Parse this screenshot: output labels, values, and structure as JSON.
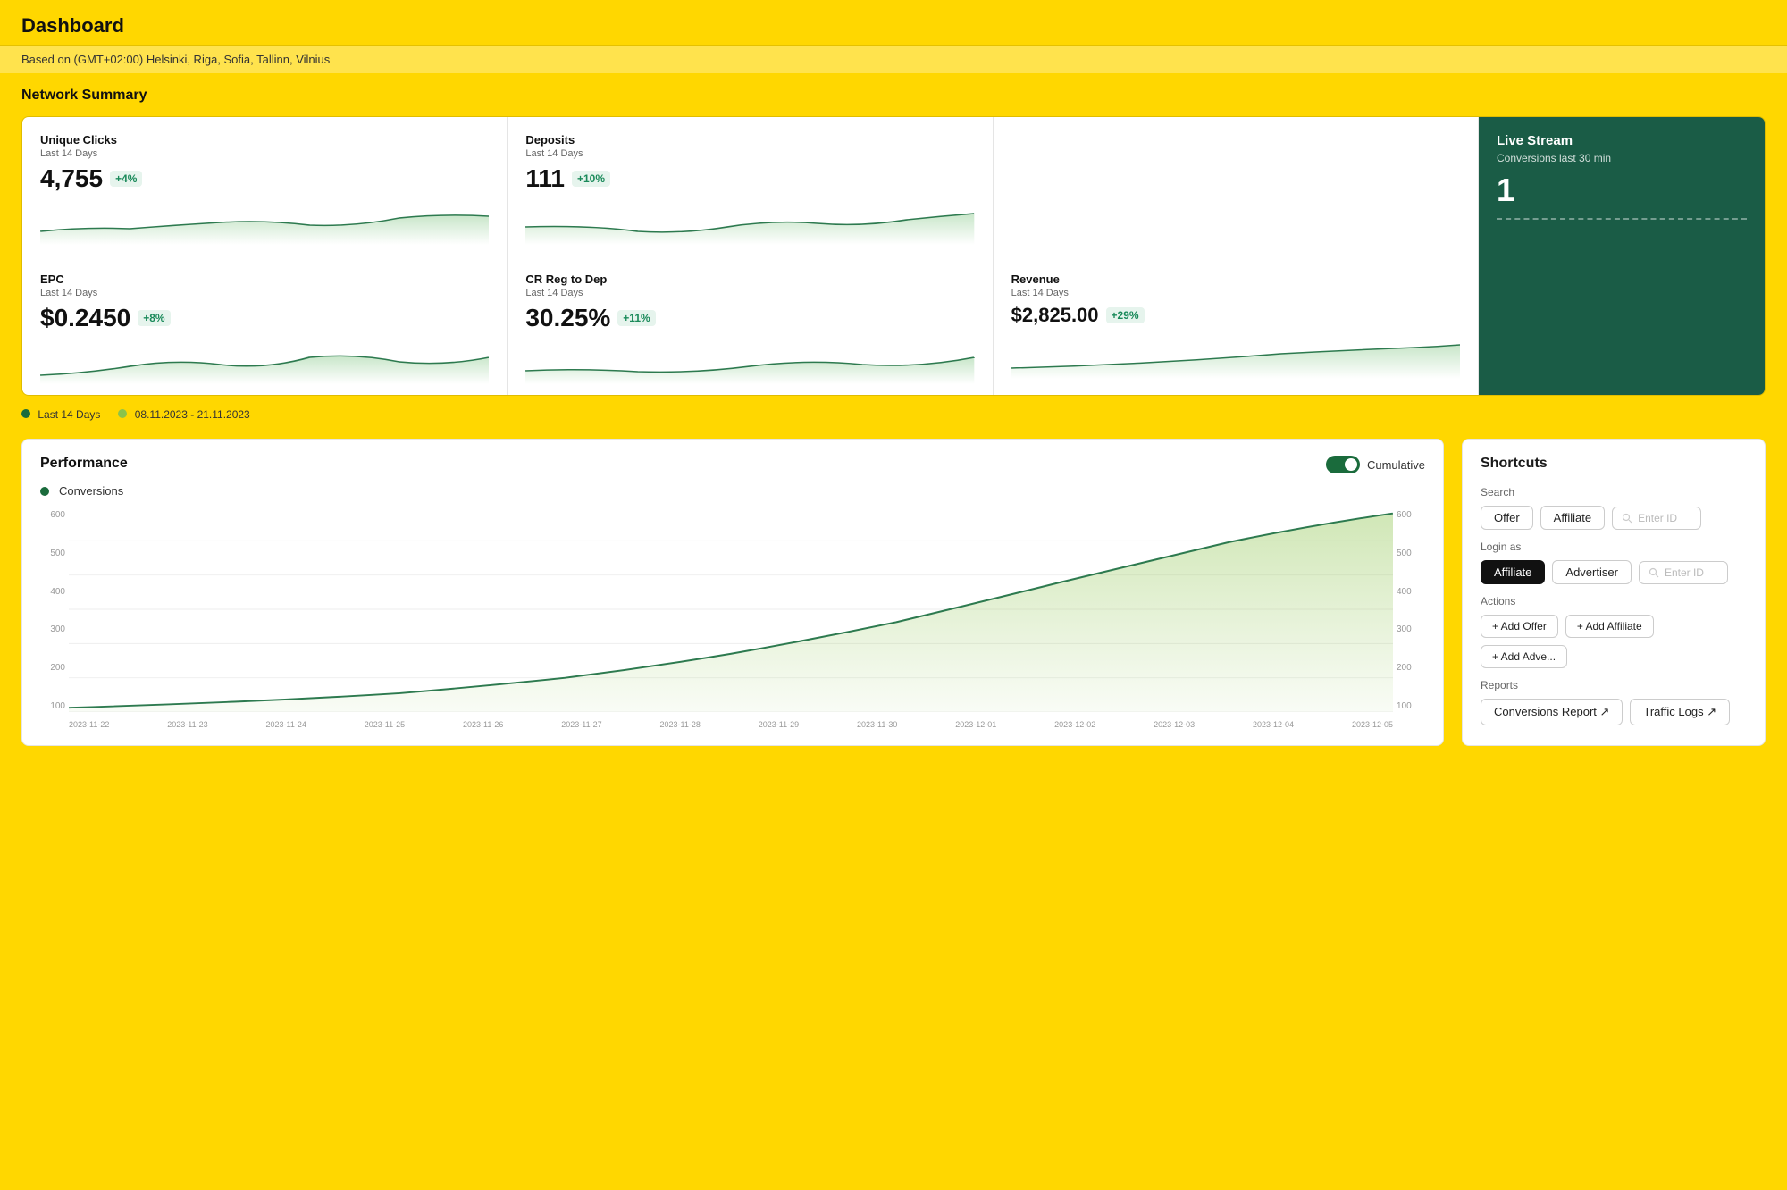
{
  "header": {
    "title": "Dashboard",
    "timezone": "Based on (GMT+02:00) Helsinki, Riga, Sofia, Tallinn, Vilnius"
  },
  "network_summary": {
    "title": "Network Summary",
    "metrics_row1": [
      {
        "id": "unique-clicks",
        "label": "Unique Clicks",
        "sublabel": "Last 14 Days",
        "value": "4,755",
        "badge": "+4%",
        "chart_type": "area"
      },
      {
        "id": "deposits",
        "label": "Deposits",
        "sublabel": "Last 14 Days",
        "value": "111",
        "badge": "+10%",
        "chart_type": "area"
      },
      {
        "id": "live-stream",
        "label": "Live Stream",
        "sublabel": "Conversions last 30 min",
        "value": "1",
        "dark": true
      }
    ],
    "metrics_row2": [
      {
        "id": "epc",
        "label": "EPC",
        "sublabel": "Last 14 Days",
        "value": "$0.2450",
        "badge": "+8%",
        "chart_type": "area"
      },
      {
        "id": "cr-reg-dep",
        "label": "CR Reg to Dep",
        "sublabel": "Last 14 Days",
        "value": "30.25%",
        "badge": "+11%",
        "chart_type": "area"
      },
      {
        "id": "revenue",
        "label": "Revenue",
        "sublabel": "Last 14 Days",
        "value": "$2,825.00",
        "badge": "+29%",
        "chart_type": "area"
      }
    ],
    "legend": {
      "item1": "Last 14 Days",
      "item2": "08.11.2023 - 21.11.2023"
    }
  },
  "performance": {
    "title": "Performance",
    "legend_label": "Conversions",
    "cumulative_label": "Cumulative",
    "y_axis_left": [
      "600",
      "500",
      "400",
      "300",
      "200",
      "100"
    ],
    "y_axis_right": [
      "600",
      "500",
      "400",
      "300",
      "200",
      "100"
    ],
    "x_axis": [
      "2023-11-22",
      "2023-11-23",
      "2023-11-24",
      "2023-11-25",
      "2023-11-26",
      "2023-11-27",
      "2023-11-28",
      "2023-11-29",
      "2023-11-30",
      "2023-12-01",
      "2023-12-02",
      "2023-12-03",
      "2023-12-04",
      "2023-12-05"
    ]
  },
  "shortcuts": {
    "title": "Shortcuts",
    "search_label": "Search",
    "search_buttons": [
      "Offer",
      "Affiliate"
    ],
    "search_input_placeholder": "Enter ID",
    "login_label": "Login as",
    "login_buttons": [
      "Affiliate",
      "Advertiser"
    ],
    "login_input_placeholder": "Enter ID",
    "actions_label": "Actions",
    "action_buttons": [
      "+ Add Offer",
      "+ Add Affiliate",
      "+ Add Adve..."
    ],
    "reports_label": "Reports",
    "report_links": [
      "Conversions Report ↗",
      "Traffic Logs ↗"
    ]
  }
}
